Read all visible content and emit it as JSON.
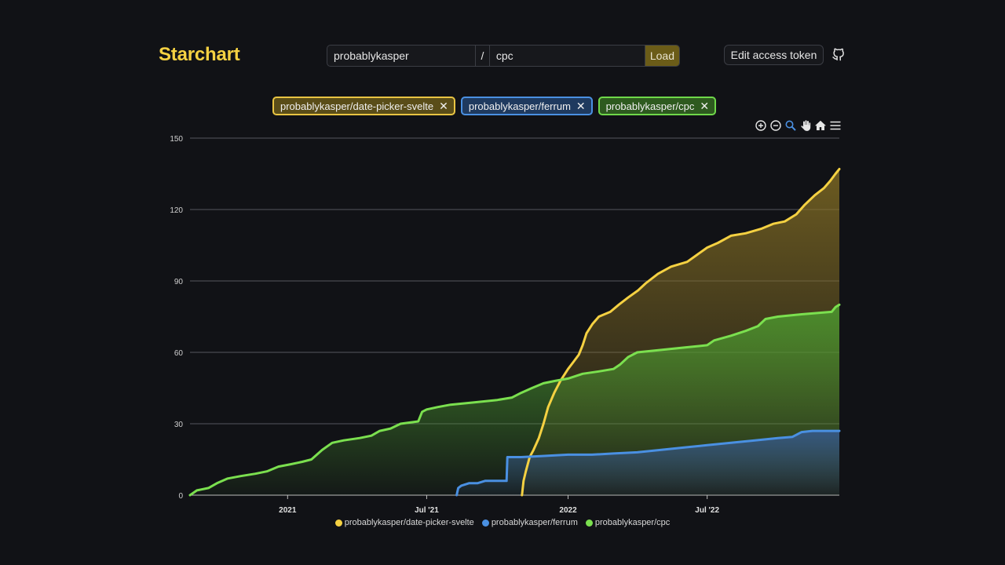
{
  "app": {
    "title": "Starchart"
  },
  "form": {
    "owner_value": "probablykasper",
    "separator": "/",
    "name_value": "cpc",
    "load_label": "Load"
  },
  "header": {
    "token_label": "Edit access token",
    "github_icon": "github-icon"
  },
  "tags": [
    {
      "label": "probablykasper/date-picker-svelte",
      "color": "#e8c443",
      "remove_icon": "close-icon"
    },
    {
      "label": "probablykasper/ferrum",
      "color": "#4a90e2",
      "remove_icon": "close-icon"
    },
    {
      "label": "probablykasper/cpc",
      "color": "#6fd84a",
      "remove_icon": "close-icon"
    }
  ],
  "toolbar": {
    "icons": [
      "zoom-in-icon",
      "zoom-out-icon",
      "selection-zoom-icon",
      "pan-hand-icon",
      "reset-home-icon",
      "menu-icon"
    ]
  },
  "chart_data": {
    "type": "area",
    "x_type": "datetime",
    "xlim": [
      "2020-08-27",
      "2022-12-20"
    ],
    "ylim": [
      0,
      150
    ],
    "y_ticks": [
      0,
      30,
      60,
      90,
      120,
      150
    ],
    "x_ticks": [
      {
        "label": "2021",
        "date": "2021-01-01"
      },
      {
        "label": "Jul '21",
        "date": "2021-07-01"
      },
      {
        "label": "2022",
        "date": "2022-01-01"
      },
      {
        "label": "Jul '22",
        "date": "2022-07-01"
      }
    ],
    "grid": true,
    "legend_position": "bottom",
    "series": [
      {
        "name": "probablykasper/date-picker-svelte",
        "color": "#f5d142",
        "points": [
          [
            "2021-11-02",
            0
          ],
          [
            "2021-11-04",
            6
          ],
          [
            "2021-11-07",
            10
          ],
          [
            "2021-11-12",
            16
          ],
          [
            "2021-11-17",
            19
          ],
          [
            "2021-11-24",
            24
          ],
          [
            "2021-11-30",
            30
          ],
          [
            "2021-12-06",
            37
          ],
          [
            "2021-12-14",
            43
          ],
          [
            "2021-12-22",
            48
          ],
          [
            "2022-01-01",
            53
          ],
          [
            "2022-01-08",
            56
          ],
          [
            "2022-01-15",
            59
          ],
          [
            "2022-01-20",
            63
          ],
          [
            "2022-01-25",
            68
          ],
          [
            "2022-02-02",
            72
          ],
          [
            "2022-02-10",
            75
          ],
          [
            "2022-02-25",
            77
          ],
          [
            "2022-03-08",
            80
          ],
          [
            "2022-03-20",
            83
          ],
          [
            "2022-04-02",
            86
          ],
          [
            "2022-04-12",
            89
          ],
          [
            "2022-04-28",
            93
          ],
          [
            "2022-05-15",
            96
          ],
          [
            "2022-06-05",
            98
          ],
          [
            "2022-06-18",
            101
          ],
          [
            "2022-07-01",
            104
          ],
          [
            "2022-07-15",
            106
          ],
          [
            "2022-08-01",
            109
          ],
          [
            "2022-08-20",
            110
          ],
          [
            "2022-09-10",
            112
          ],
          [
            "2022-09-25",
            114
          ],
          [
            "2022-10-10",
            115
          ],
          [
            "2022-10-25",
            118
          ],
          [
            "2022-11-05",
            122
          ],
          [
            "2022-11-18",
            126
          ],
          [
            "2022-11-30",
            129
          ],
          [
            "2022-12-08",
            132
          ],
          [
            "2022-12-15",
            135
          ],
          [
            "2022-12-20",
            137
          ]
        ]
      },
      {
        "name": "probablykasper/ferrum",
        "color": "#4a90e2",
        "points": [
          [
            "2021-08-09",
            0
          ],
          [
            "2021-08-11",
            3
          ],
          [
            "2021-08-15",
            4
          ],
          [
            "2021-08-25",
            5
          ],
          [
            "2021-09-05",
            5
          ],
          [
            "2021-09-15",
            6
          ],
          [
            "2021-10-13",
            6
          ],
          [
            "2021-10-14",
            16
          ],
          [
            "2021-11-01",
            16
          ],
          [
            "2021-12-01",
            16.5
          ],
          [
            "2022-01-01",
            17
          ],
          [
            "2022-02-01",
            17
          ],
          [
            "2022-03-01",
            17.5
          ],
          [
            "2022-04-01",
            18
          ],
          [
            "2022-05-01",
            19
          ],
          [
            "2022-06-01",
            20
          ],
          [
            "2022-07-01",
            21
          ],
          [
            "2022-08-01",
            22
          ],
          [
            "2022-09-01",
            23
          ],
          [
            "2022-10-01",
            24
          ],
          [
            "2022-10-20",
            24.5
          ],
          [
            "2022-11-01",
            26.5
          ],
          [
            "2022-11-15",
            27
          ],
          [
            "2022-12-20",
            27
          ]
        ]
      },
      {
        "name": "probablykasper/cpc",
        "color": "#7be04f",
        "points": [
          [
            "2020-08-27",
            0
          ],
          [
            "2020-09-05",
            2
          ],
          [
            "2020-09-20",
            3
          ],
          [
            "2020-10-01",
            5
          ],
          [
            "2020-10-15",
            7
          ],
          [
            "2020-11-01",
            8
          ],
          [
            "2020-11-20",
            9
          ],
          [
            "2020-12-05",
            10
          ],
          [
            "2020-12-20",
            12
          ],
          [
            "2021-01-05",
            13
          ],
          [
            "2021-01-20",
            14
          ],
          [
            "2021-02-01",
            15
          ],
          [
            "2021-02-15",
            19
          ],
          [
            "2021-02-28",
            22
          ],
          [
            "2021-03-15",
            23
          ],
          [
            "2021-04-05",
            24
          ],
          [
            "2021-04-20",
            25
          ],
          [
            "2021-05-01",
            27
          ],
          [
            "2021-05-15",
            28
          ],
          [
            "2021-05-28",
            30
          ],
          [
            "2021-06-20",
            31
          ],
          [
            "2021-06-25",
            35
          ],
          [
            "2021-07-01",
            36
          ],
          [
            "2021-07-15",
            37
          ],
          [
            "2021-08-01",
            38
          ],
          [
            "2021-09-01",
            39
          ],
          [
            "2021-10-01",
            40
          ],
          [
            "2021-10-20",
            41
          ],
          [
            "2021-11-01",
            43
          ],
          [
            "2021-11-15",
            45
          ],
          [
            "2021-11-30",
            47
          ],
          [
            "2021-12-15",
            48
          ],
          [
            "2022-01-01",
            49
          ],
          [
            "2022-01-20",
            51
          ],
          [
            "2022-02-10",
            52
          ],
          [
            "2022-03-01",
            53
          ],
          [
            "2022-03-10",
            55
          ],
          [
            "2022-03-20",
            58
          ],
          [
            "2022-04-01",
            60
          ],
          [
            "2022-05-01",
            61
          ],
          [
            "2022-06-01",
            62
          ],
          [
            "2022-07-01",
            63
          ],
          [
            "2022-07-10",
            65
          ],
          [
            "2022-08-01",
            67
          ],
          [
            "2022-08-20",
            69
          ],
          [
            "2022-09-05",
            71
          ],
          [
            "2022-09-15",
            74
          ],
          [
            "2022-10-01",
            75
          ],
          [
            "2022-11-01",
            76
          ],
          [
            "2022-12-10",
            77
          ],
          [
            "2022-12-15",
            79
          ],
          [
            "2022-12-20",
            80
          ]
        ]
      }
    ]
  }
}
